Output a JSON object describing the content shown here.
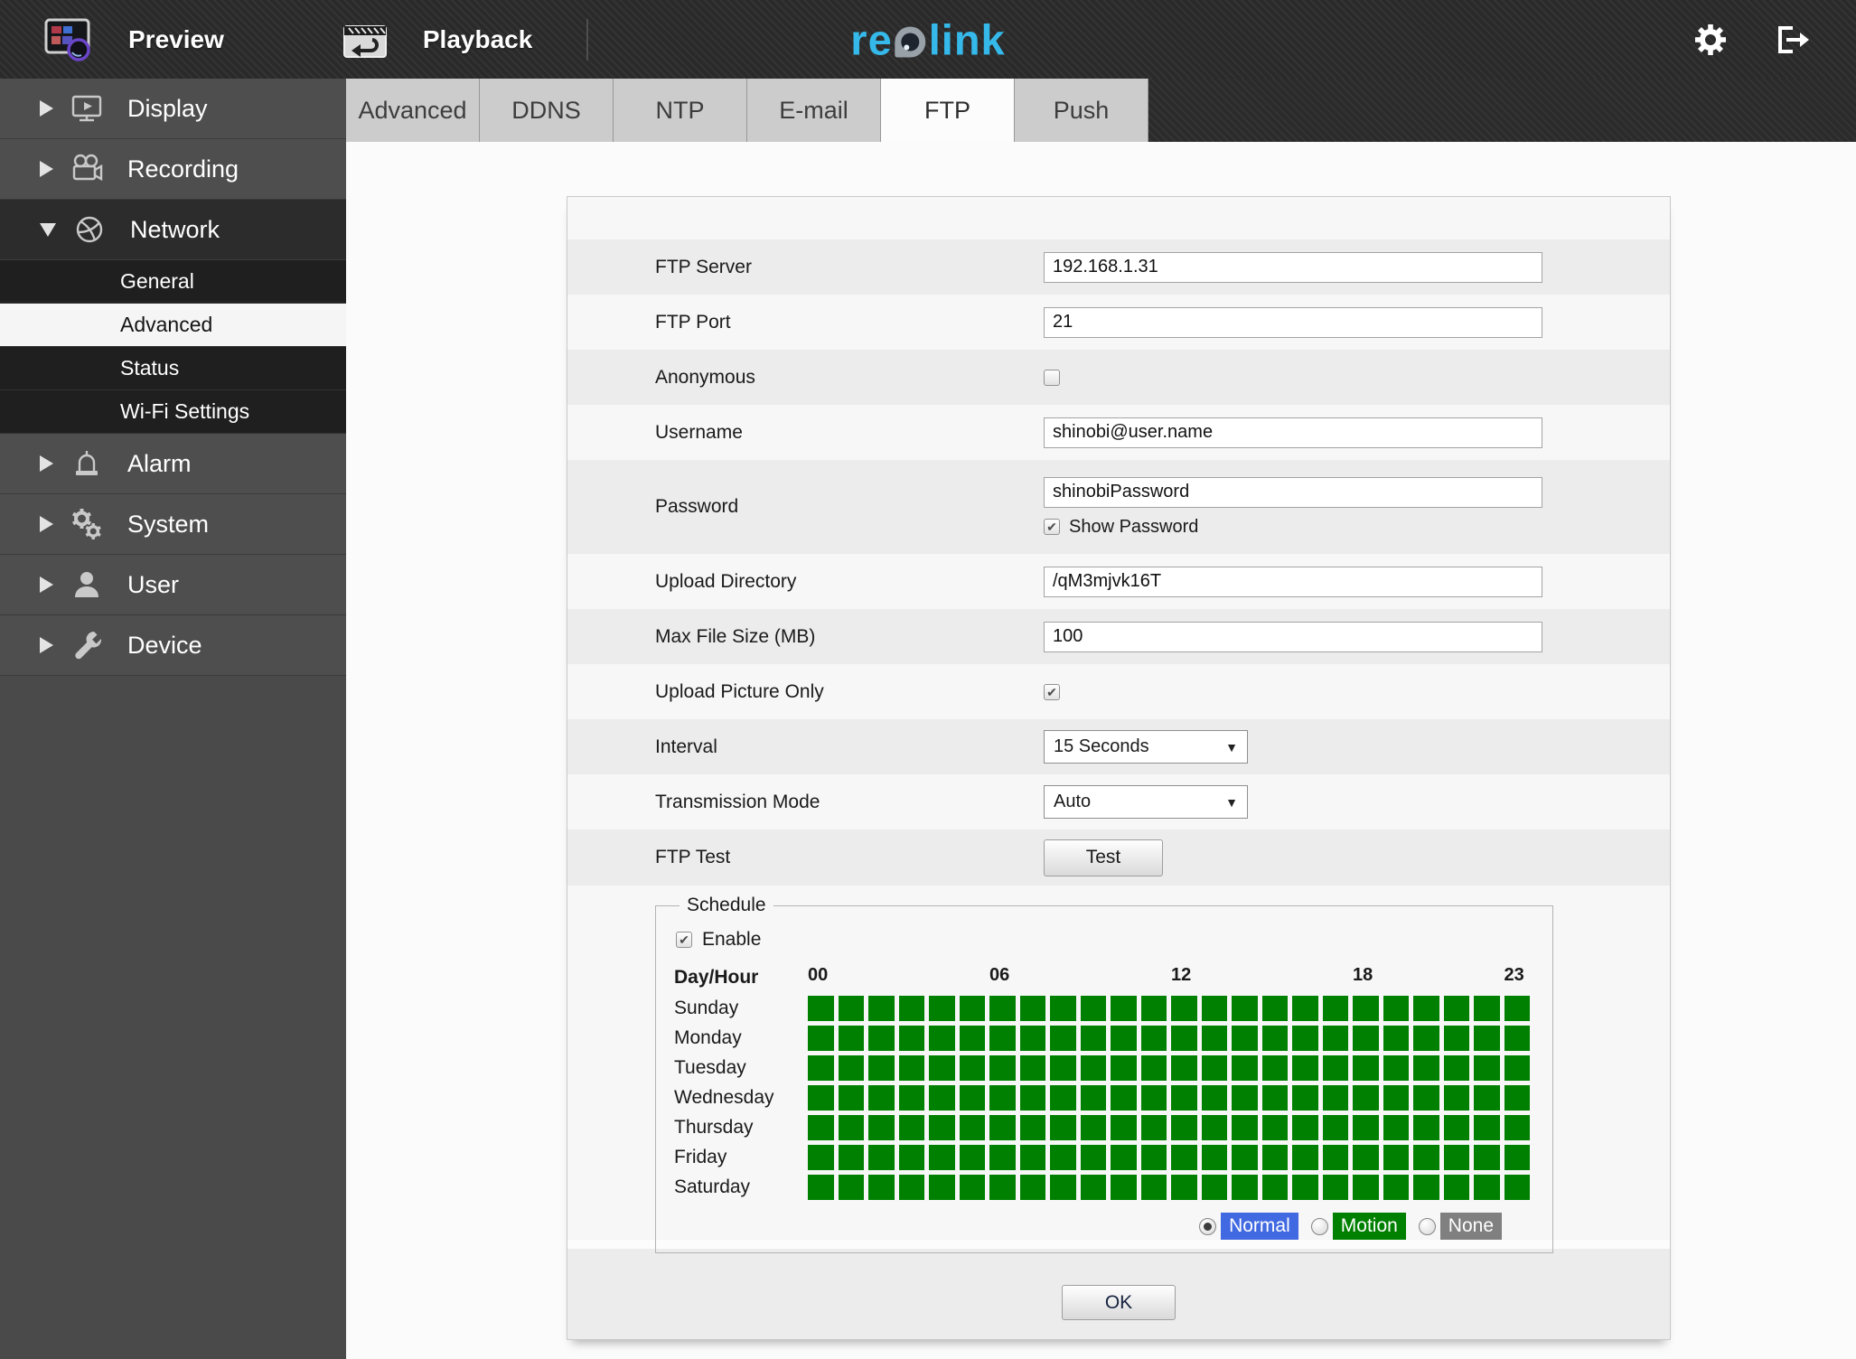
{
  "topnav": {
    "preview_label": "Preview",
    "playback_label": "Playback",
    "logo": {
      "part1": "re",
      "part2": "link"
    }
  },
  "sidebar": {
    "items": [
      {
        "label": "Display"
      },
      {
        "label": "Recording"
      },
      {
        "label": "Network"
      },
      {
        "label": "Alarm"
      },
      {
        "label": "System"
      },
      {
        "label": "User"
      },
      {
        "label": "Device"
      }
    ],
    "network_children": [
      {
        "label": "General"
      },
      {
        "label": "Advanced",
        "selected": true
      },
      {
        "label": "Status"
      },
      {
        "label": "Wi-Fi Settings"
      }
    ]
  },
  "tabs": {
    "items": [
      {
        "label": "Advanced"
      },
      {
        "label": "DDNS"
      },
      {
        "label": "NTP"
      },
      {
        "label": "E-mail"
      },
      {
        "label": "FTP"
      },
      {
        "label": "Push"
      }
    ],
    "active": "FTP"
  },
  "form": {
    "ftp_server": {
      "label": "FTP Server",
      "value": "192.168.1.31"
    },
    "ftp_port": {
      "label": "FTP Port",
      "value": "21"
    },
    "anonymous": {
      "label": "Anonymous",
      "checked": false
    },
    "username": {
      "label": "Username",
      "value": "shinobi@user.name"
    },
    "password": {
      "label": "Password",
      "value": "shinobiPassword",
      "show_password_label": "Show Password",
      "show_password_checked": true
    },
    "upload_directory": {
      "label": "Upload Directory",
      "value": "/qM3mjvk16T"
    },
    "max_file_size": {
      "label": "Max File Size (MB)",
      "value": "100"
    },
    "upload_picture_only": {
      "label": "Upload Picture Only",
      "checked": true
    },
    "interval": {
      "label": "Interval",
      "value": "15 Seconds"
    },
    "transmission_mode": {
      "label": "Transmission Mode",
      "value": "Auto"
    },
    "ftp_test": {
      "label": "FTP Test",
      "button": "Test"
    }
  },
  "schedule": {
    "legend": "Schedule",
    "enable_label": "Enable",
    "enable_checked": true,
    "day_hour_label": "Day/Hour",
    "hour_labels": [
      {
        "text": "00",
        "col": 0
      },
      {
        "text": "06",
        "col": 6
      },
      {
        "text": "12",
        "col": 12
      },
      {
        "text": "18",
        "col": 18
      },
      {
        "text": "23",
        "col": 23
      }
    ],
    "days": [
      "Sunday",
      "Monday",
      "Tuesday",
      "Wednesday",
      "Thursday",
      "Friday",
      "Saturday"
    ],
    "columns": 24,
    "all_cells_state": "motion",
    "cell_color": "#008000",
    "modes": [
      {
        "label": "Normal",
        "color": "#4169e1",
        "selected": true
      },
      {
        "label": "Motion",
        "color": "#008000",
        "selected": false
      },
      {
        "label": "None",
        "color": "#808080",
        "selected": false
      }
    ]
  },
  "footer": {
    "ok_label": "OK"
  },
  "colors": {
    "accent_blue": "#35b9ea",
    "grid_green": "#008000",
    "normal_blue": "#4169e1",
    "none_gray": "#808080"
  }
}
